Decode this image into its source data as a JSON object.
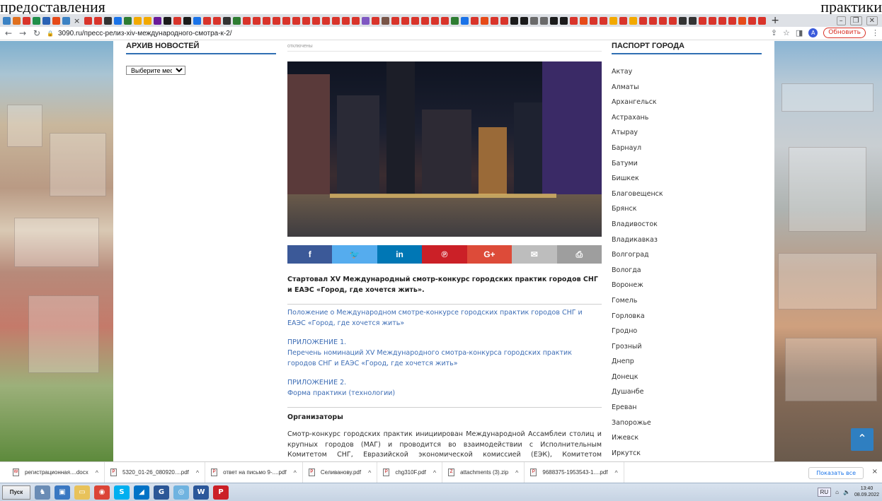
{
  "overlay": {
    "left_text": "предоставления",
    "right_text": "практики"
  },
  "tabs": {
    "favicon_colors": [
      "#3b82c4",
      "#e0701f",
      "#d9342b",
      "#1f8f4a",
      "#2a62b5",
      "#e64a19",
      "#3b82c4",
      "#d9342b",
      "#d9342b",
      "#333333",
      "#1a73e8",
      "#2e7d32",
      "#f2a900",
      "#f2a900",
      "#6a1b9a",
      "#1b1b1b",
      "#d9342b",
      "#1b1b1b",
      "#1a73e8",
      "#d9342b",
      "#d9342b",
      "#333333",
      "#2e7d32",
      "#d9342b",
      "#d9342b",
      "#d9342b",
      "#d9342b",
      "#d9342b",
      "#d9342b",
      "#d9342b",
      "#d9342b",
      "#d9342b",
      "#d9342b",
      "#d9342b",
      "#d9342b",
      "#7e57c2",
      "#d9342b",
      "#795548",
      "#d9342b",
      "#d9342b",
      "#d9342b",
      "#d9342b",
      "#d9342b",
      "#d9342b",
      "#2e7d32",
      "#1a73e8",
      "#d9342b",
      "#e64a19",
      "#d9342b",
      "#d9342b",
      "#1b1b1b",
      "#1b1b1b",
      "#6a6a6a",
      "#6a6a6a",
      "#1b1b1b",
      "#1b1b1b",
      "#d9342b",
      "#e64a19",
      "#d9342b",
      "#d9342b",
      "#f2a900",
      "#d9342b",
      "#f2a900",
      "#d9342b",
      "#d9342b",
      "#d9342b",
      "#d9342b",
      "#333333",
      "#333333",
      "#d9342b",
      "#d9342b",
      "#d9342b",
      "#d9342b",
      "#e64a19",
      "#d9342b",
      "#d9342b"
    ],
    "close_glyph": "×",
    "new_tab_glyph": "+"
  },
  "address_bar": {
    "url": "3090.ru/пресс-релиз-xiv-международного-смотра-к-2/",
    "update_button": "Обновить",
    "avatar_letter": "A"
  },
  "left_sidebar": {
    "title": "АРХИВ НОВОСТЕЙ",
    "month_select": "Выберите месяц"
  },
  "main": {
    "comments_state": "отключены",
    "share_buttons": [
      {
        "label": "f",
        "color": "#3b5998"
      },
      {
        "label": "🐦",
        "color": "#55acee"
      },
      {
        "label": "in",
        "color": "#0077b5"
      },
      {
        "label": "℗",
        "color": "#cb2027"
      },
      {
        "label": "G+",
        "color": "#dd4b39"
      },
      {
        "label": "✉",
        "color": "#bdbdbd"
      },
      {
        "label": "⎙",
        "color": "#9e9e9e"
      }
    ],
    "headline": "Стартовал XV Международный смотр-конкурс городских практик городов СНГ и ЕАЭС «Город, где хочется жить».",
    "link1": "Положение о Международном смотре-конкурсе городских практик городов СНГ и ЕАЭС «Город, где хочется жить»",
    "appendix1_title": "ПРИЛОЖЕНИЕ 1.",
    "appendix1_text": "Перечень номинаций XV Международного смотра-конкурса городских практик городов СНГ и ЕАЭС «Город, где хочется жить»",
    "appendix2_title": "ПРИЛОЖЕНИЕ 2.",
    "appendix2_text": "Форма практики (технологии)",
    "organizers_title": "Организаторы",
    "organizers_text": "Смотр-конкурс городских практик инициирован Международной Ассамблеи столиц и крупных городов (МАГ) и проводится во взаимодействии с Исполнительным Комитетом СНГ, Евразийской экономической комиссией (ЕЭК), Комитетом Государственной Думы РФ по федеративному"
  },
  "right_sidebar": {
    "title": "ПАСПОРТ ГОРОДА",
    "cities": [
      "Актау",
      "Алматы",
      "Архангельск",
      "Астрахань",
      "Атырау",
      "Барнаул",
      "Батуми",
      "Бишкек",
      "Благовещенск",
      "Брянск",
      "Владивосток",
      "Владикавказ",
      "Волгоград",
      "Вологда",
      "Воронеж",
      "Гомель",
      "Горловка",
      "Гродно",
      "Грозный",
      "Днепр",
      "Донецк",
      "Душанбе",
      "Ереван",
      "Запорожье",
      "Ижевск",
      "Иркутск"
    ]
  },
  "downloads": {
    "items": [
      {
        "name": "регистрационная....docx",
        "icon": "W"
      },
      {
        "name": "5320_01-26_080920....pdf",
        "icon": "P"
      },
      {
        "name": "ответ на письмо 9-....pdf",
        "icon": "P"
      },
      {
        "name": "Селиванову.pdf",
        "icon": "P"
      },
      {
        "name": "chg310F.pdf",
        "icon": "P"
      },
      {
        "name": "attachments (3).zip",
        "icon": "Z"
      },
      {
        "name": "9688375-1953543-1....pdf",
        "icon": "P"
      }
    ],
    "show_all": "Показать все",
    "chevron": "^",
    "close": "×"
  },
  "taskbar": {
    "start_label": "Пуск",
    "apps": [
      {
        "name": "user-accounts",
        "color": "#6a8cb5",
        "glyph": "♞"
      },
      {
        "name": "explorer",
        "color": "#3a78c2",
        "glyph": "▣"
      },
      {
        "name": "folder",
        "color": "#e8c25a",
        "glyph": "▭"
      },
      {
        "name": "chrome",
        "color": "#db4437",
        "glyph": "◉"
      },
      {
        "name": "skype",
        "color": "#00aff0",
        "glyph": "S"
      },
      {
        "name": "outlook",
        "color": "#0072c6",
        "glyph": "◢"
      },
      {
        "name": "app-g",
        "color": "#2b5797",
        "glyph": "G"
      },
      {
        "name": "browser2",
        "color": "#6fb3e0",
        "glyph": "◎"
      },
      {
        "name": "word",
        "color": "#2b579a",
        "glyph": "W"
      },
      {
        "name": "pinterest",
        "color": "#cb2027",
        "glyph": "P"
      }
    ],
    "lang": "RU",
    "time": "13:40",
    "date": "08.09.2022"
  }
}
